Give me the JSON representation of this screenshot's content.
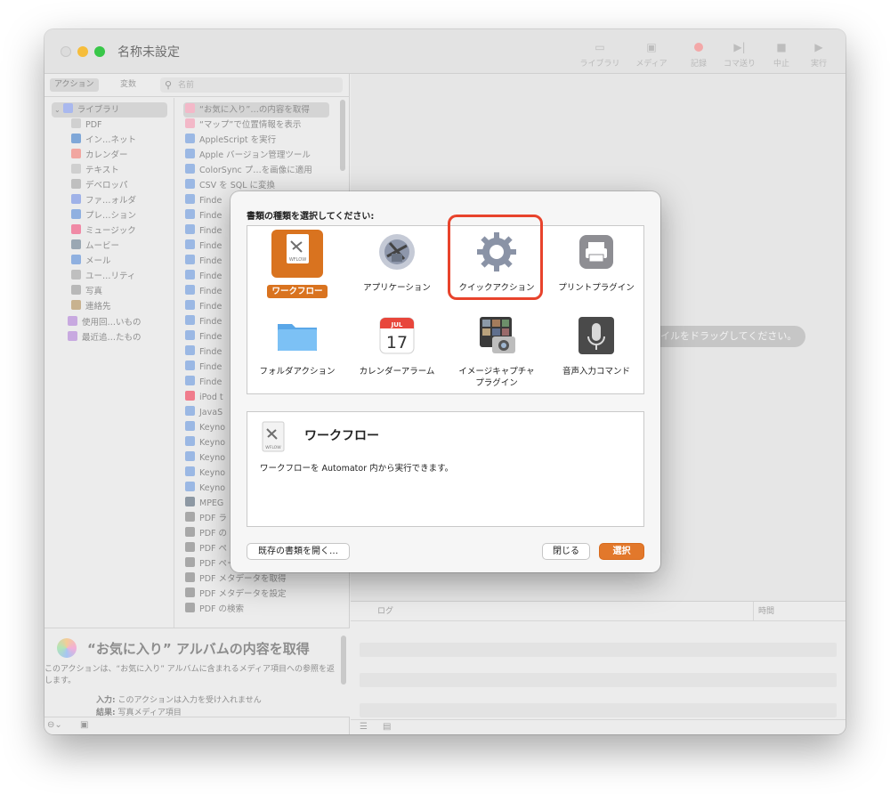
{
  "window": {
    "title": "名称未設定"
  },
  "toolbar": {
    "library": "ライブラリ",
    "media": "メディア",
    "record": "記録",
    "step": "コマ送り",
    "stop": "中止",
    "run": "実行"
  },
  "sidebar_tabs": {
    "actions": "アクション",
    "variables": "変数"
  },
  "search": {
    "placeholder": "名前"
  },
  "library": {
    "root": "ライブラリ",
    "items": [
      "PDF",
      "イン…ネット",
      "カレンダー",
      "テキスト",
      "デベロッパ",
      "ファ…ォルダ",
      "プレ…ション",
      "ミュージック",
      "ムービー",
      "メール",
      "ユー…リティ",
      "写真",
      "連絡先"
    ],
    "groups": [
      "使用回…いもの",
      "最近追…たもの"
    ]
  },
  "actions": {
    "items": [
      "“お気に入り”…の内容を取得",
      "“マップ”で位置情報を表示",
      "AppleScript を実行",
      "Apple バージョン管理ツール",
      "ColorSync プ…を画像に適用",
      "CSV を SQL に変換",
      "Finde",
      "Finde",
      "Finde",
      "Finde",
      "Finde",
      "Finde",
      "Finde",
      "Finde",
      "Finde",
      "Finde",
      "Finde",
      "Finde",
      "Finde",
      "iPod t",
      "JavaS",
      "Keyno",
      "Keyno",
      "Keyno",
      "Keyno",
      "Keyno",
      "MPEG",
      "PDF ラ",
      "PDF の",
      "PDF ペ",
      "PDF ページを結合",
      "PDF メタデータを取得",
      "PDF メタデータを設定",
      "PDF の検索"
    ]
  },
  "description": {
    "title": "“お気に入り” アルバムの内容を取得",
    "text": "このアクションは、“お気に入り” アルバムに含まれるメディア項目への参照を返します。",
    "input_label": "入力:",
    "input_value": "このアクションは入力を受け入れません",
    "result_label": "結果:",
    "result_value": "写真メディア項目"
  },
  "canvas": {
    "hint": "イルをドラッグしてください。"
  },
  "log": {
    "col_log": "ログ",
    "col_time": "時間"
  },
  "dialog": {
    "prompt": "書類の種類を選択してください:",
    "types": [
      "ワークフロー",
      "アプリケーション",
      "クイックアクション",
      "プリントプラグイン",
      "フォルダアクション",
      "カレンダーアラーム",
      "イメージキャプチャ\nプラグイン",
      "音声入力コマンド"
    ],
    "calendar_month": "JUL",
    "calendar_day": "17",
    "wflow_tag": "WFLOW",
    "selected_title": "ワークフロー",
    "selected_description": "ワークフローを Automator 内から実行できます。",
    "open_existing": "既存の書類を開く…",
    "close": "閉じる",
    "choose": "選択"
  },
  "colors": {
    "accent": "#e2782b",
    "highlight_ring": "#e8432c"
  }
}
